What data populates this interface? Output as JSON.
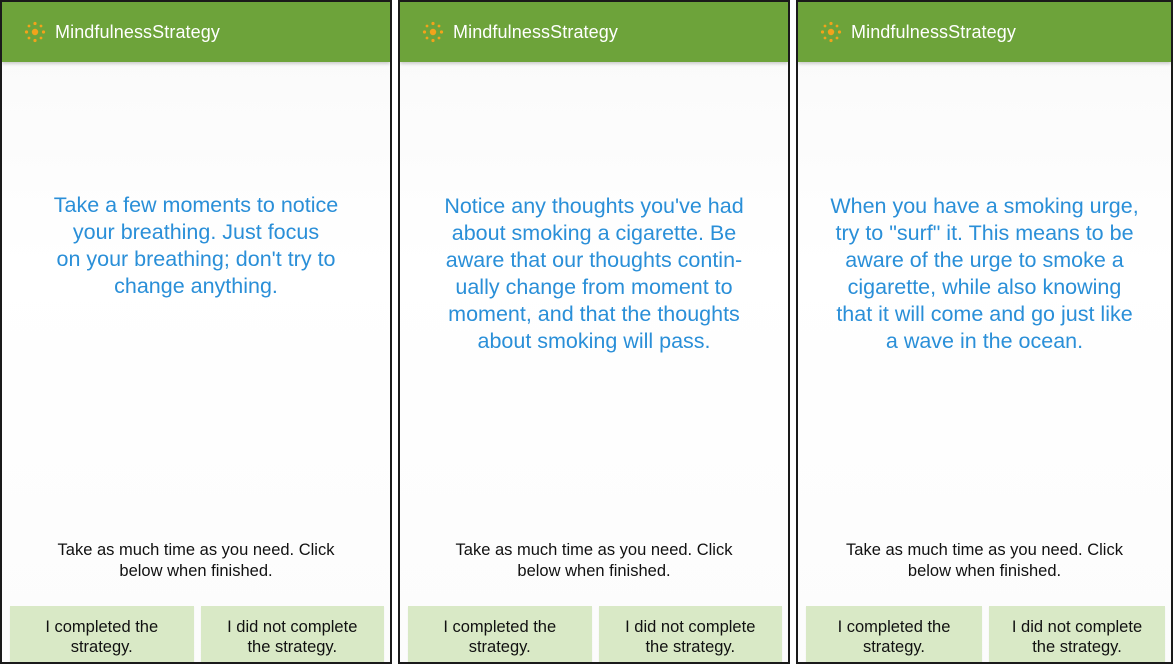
{
  "app_title": "MindfulnessStrategy",
  "colors": {
    "appbar": "#6da33a",
    "prompt_text": "#2a8fd8",
    "button_bg": "#d9e9c6",
    "icon": "#f2a31b"
  },
  "screens": [
    {
      "prompt": "Take a few moments to notice\nyour breathing. Just focus\non your breathing; don't try to\nchange anything.",
      "instruction": "Take as much time as you need. Click\nbelow when finished.",
      "completed_label": "I completed the\nstrategy.",
      "not_completed_label": "I did not complete\nthe strategy."
    },
    {
      "prompt": "Notice any thoughts you've had\nabout smoking a cigarette. Be\naware that our thoughts contin-\nually change from moment to\nmoment, and that the thoughts\nabout smoking will pass.",
      "instruction": "Take as much time as you need. Click\nbelow when finished.",
      "completed_label": "I completed the\nstrategy.",
      "not_completed_label": "I did not complete\nthe strategy."
    },
    {
      "prompt": "When you have a smoking urge,\ntry to \"surf\" it. This means to be\naware of the urge to smoke a\ncigarette, while also knowing\nthat it will come and go just like\na wave in the ocean.",
      "instruction": "Take as much time as you need. Click\nbelow when finished.",
      "completed_label": "I completed the\nstrategy.",
      "not_completed_label": "I did not complete\nthe strategy."
    }
  ]
}
